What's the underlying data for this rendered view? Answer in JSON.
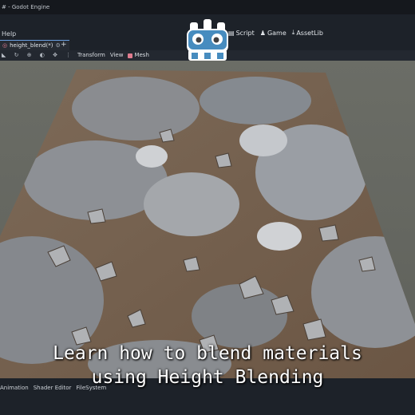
{
  "window": {
    "title": "# - Godot Engine"
  },
  "menu": {
    "help": "Help"
  },
  "workspaces": [
    {
      "icon": "script-icon",
      "label": "Script"
    },
    {
      "icon": "game-icon",
      "label": "Game"
    },
    {
      "icon": "assetlib-icon",
      "label": "AssetLib"
    }
  ],
  "tab": {
    "label": "height_blend(*)",
    "settings": "⚙",
    "close": "×",
    "add": "+"
  },
  "toolbar": {
    "tools": "◣ ↻ ⊕ ◐ ✥ ⋮",
    "transform": "Transform",
    "view": "View",
    "mesh": "Mesh"
  },
  "bottom_tabs": [
    "Animation",
    "Shader Editor",
    "FileSystem"
  ],
  "caption": {
    "line1": "Learn how to blend materials",
    "line2": "using Height Blending"
  },
  "colors": {
    "accent": "#6a9fe0",
    "mesh": "#e07c8f",
    "logo_blue": "#478cbf"
  }
}
